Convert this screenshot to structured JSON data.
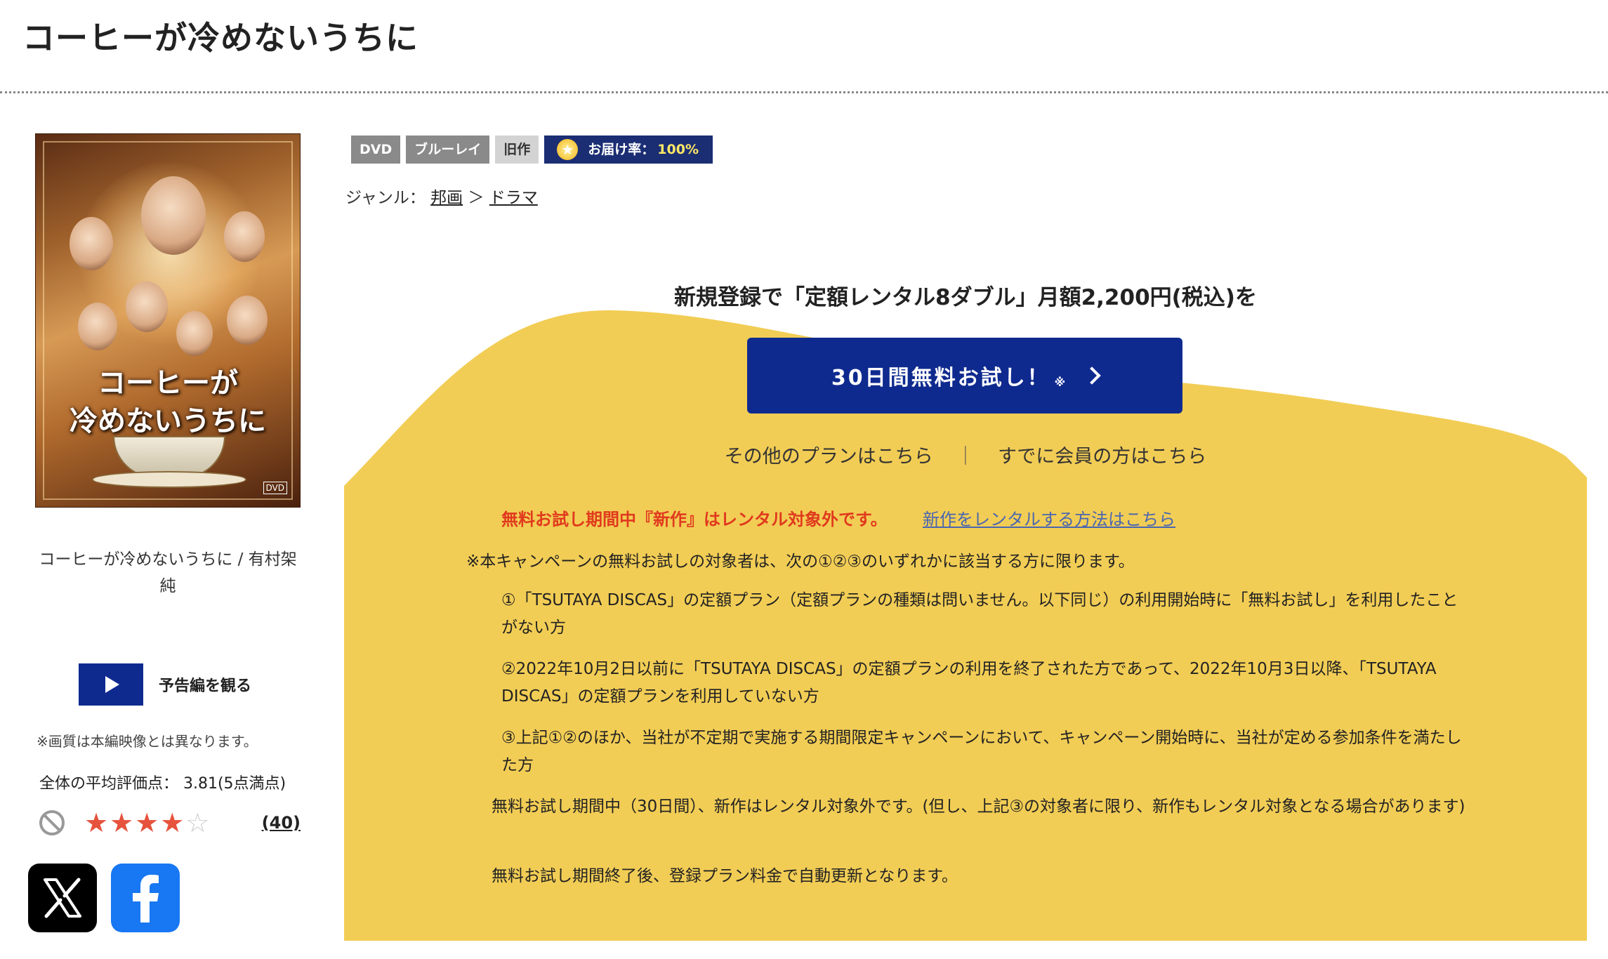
{
  "page": {
    "title": "コーヒーが冷めないうちに"
  },
  "product": {
    "poster_title_line1": "コーヒーが",
    "poster_title_line2": "冷めないうちに",
    "poster_badge": "DVD",
    "name": "コーヒーが冷めないうちに / 有村架純",
    "trailer_label": "予告編を観る",
    "trailer_note": "※画質は本編映像とは異なります。",
    "average_rating_text": "全体の平均評価点： 3.81(5点満点)",
    "stars": {
      "filled": 4,
      "total": 5
    },
    "review_count": "(40)"
  },
  "sns": [
    {
      "name": "x",
      "icon": "x-logo-icon"
    },
    {
      "name": "facebook",
      "icon": "facebook-logo-icon"
    }
  ],
  "tags": {
    "dvd": "DVD",
    "bluray": "ブルーレイ",
    "old": "旧作",
    "delivery_label": "お届け率：",
    "delivery_rate": "100%"
  },
  "genre": {
    "label": "ジャンル：",
    "level1": "邦画",
    "separator": "＞",
    "level2": "ドラマ"
  },
  "promo": {
    "headline": "新規登録で「定額レンタル8ダブル」月額2,200円(税込)を",
    "cta_label": "30日間無料お試し！",
    "cta_mark": "※",
    "other_plans": "その他のプランはこちら",
    "divider": "｜",
    "members": "すでに会員の方はこちら",
    "warning": "無料お試し期間中『新作』はレンタル対象外です。",
    "warning_link": "新作をレンタルする方法はこちら",
    "terms_intro": "※本キャンペーンの無料お試しの対象者は、次の①②③のいずれかに該当する方に限ります。",
    "conditions": [
      "①「TSUTAYA DISCAS」の定額プラン（定額プランの種類は問いません。以下同じ）の利用開始時に「無料お試し」を利用したことがない方",
      "②2022年10月2日以前に「TSUTAYA DISCAS」の定額プランの利用を終了された方であって、2022年10月3日以降、「TSUTAYA DISCAS」の定額プランを利用していない方",
      "③上記①②のほか、当社が不定期で実施する期間限定キャンペーンにおいて、キャンペーン開始時に、当社が定める参加条件を満たした方"
    ],
    "notes": [
      "無料お試し期間中（30日間）、新作はレンタル対象外です。(但し、上記③の対象者に限り、新作もレンタル対象となる場合があります)",
      "無料お試し期間終了後、登録プラン料金で自動更新となります。"
    ]
  },
  "colors": {
    "accent_navy": "#0f2a8f",
    "promo_yellow": "#f2cd55",
    "warning_red": "#e03a1e",
    "star_red": "#e6523c"
  }
}
